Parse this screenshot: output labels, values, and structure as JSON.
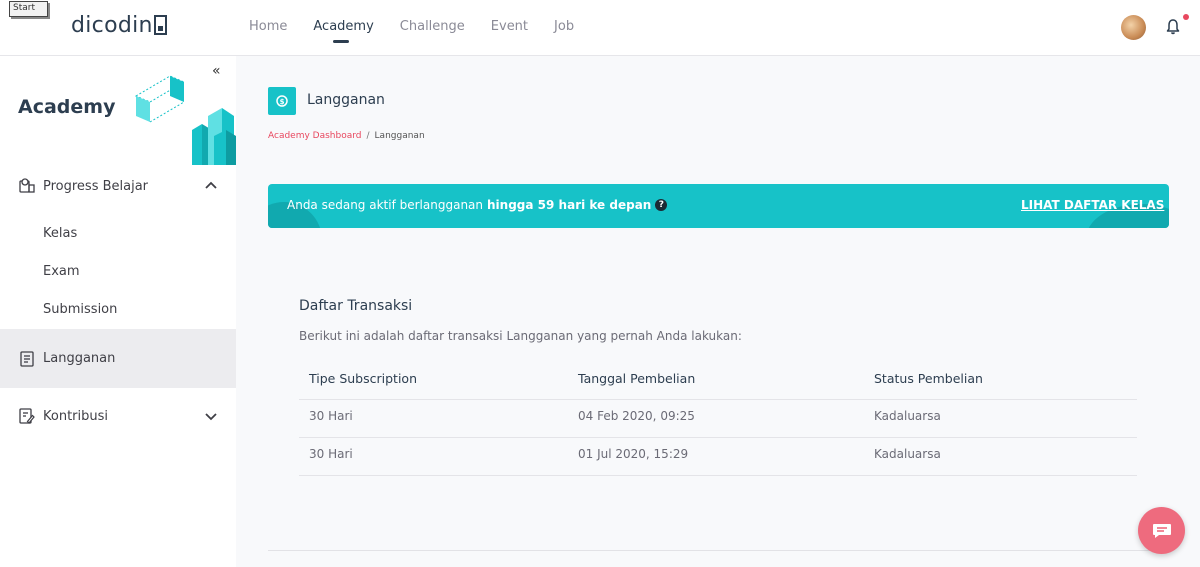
{
  "start_tag": "Start",
  "header": {
    "logo_text": "dicodin",
    "nav": [
      "Home",
      "Academy",
      "Challenge",
      "Event",
      "Job"
    ],
    "active_nav": "Academy"
  },
  "sidebar": {
    "collapse_glyph": "«",
    "title": "Academy",
    "menu": {
      "progress": "Progress Belajar",
      "sub_items": [
        "Kelas",
        "Exam",
        "Submission"
      ],
      "langganan": "Langganan",
      "kontribusi": "Kontribusi"
    }
  },
  "page": {
    "title": "Langganan",
    "breadcrumb": {
      "link": "Academy Dashboard",
      "separator": "/",
      "current": "Langganan"
    }
  },
  "banner": {
    "text": "Anda sedang aktif berlangganan",
    "strong": "hingga 59 hari ke depan",
    "help_glyph": "?",
    "link": "LIHAT DAFTAR KELAS"
  },
  "transactions": {
    "title": "Daftar Transaksi",
    "description": "Berikut ini adalah daftar transaksi Langganan yang pernah Anda lakukan:",
    "columns": [
      "Tipe Subscription",
      "Tanggal Pembelian",
      "Status Pembelian"
    ],
    "rows": [
      [
        "30 Hari",
        "04 Feb 2020, 09:25",
        "Kadaluarsa"
      ],
      [
        "30 Hari",
        "01 Jul 2020, 15:29",
        "Kadaluarsa"
      ]
    ]
  },
  "colors": {
    "accent": "#17c2c8",
    "brand_dark": "#2d3e50",
    "link_red": "#e8485f",
    "chat": "#ee6b7e"
  }
}
